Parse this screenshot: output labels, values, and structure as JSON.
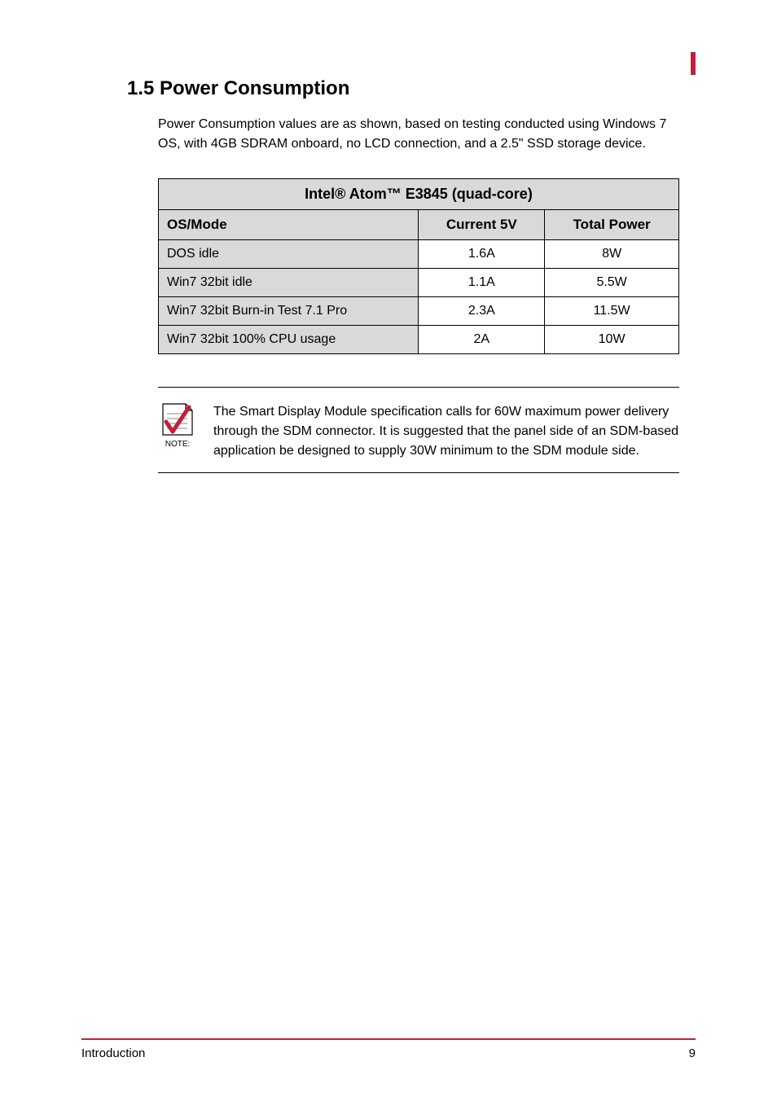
{
  "section": {
    "number": "1.5",
    "title": "Power Consumption",
    "intro": "Power Consumption values are as shown, based on testing conducted using Windows 7 OS, with 4GB SDRAM onboard, no LCD connection, and a 2.5\" SSD storage device."
  },
  "table": {
    "title": "Intel® Atom™ E3845 (quad-core)",
    "headers": {
      "os_mode": "OS/Mode",
      "current": "Current 5V",
      "power": "Total Power"
    },
    "rows": [
      {
        "os_mode": "DOS idle",
        "current": "1.6A",
        "power": "8W"
      },
      {
        "os_mode": "Win7 32bit idle",
        "current": "1.1A",
        "power": "5.5W"
      },
      {
        "os_mode": "Win7 32bit Burn-in Test 7.1 Pro",
        "current": "2.3A",
        "power": "11.5W"
      },
      {
        "os_mode": "Win7 32bit 100% CPU usage",
        "current": "2A",
        "power": "10W"
      }
    ]
  },
  "note": {
    "label": "NOTE:",
    "text": "The Smart Display Module specification calls for 60W maximum power delivery through the SDM connector. It is suggested that the panel side of an SDM-based application be designed to supply 30W minimum to the SDM module side."
  },
  "footer": {
    "left": "Introduction",
    "right": "9"
  }
}
